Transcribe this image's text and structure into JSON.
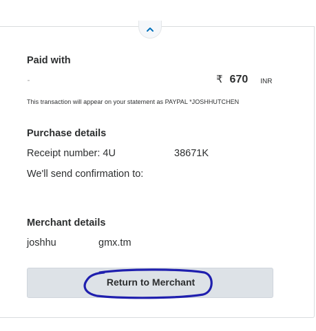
{
  "paid_with": {
    "title": "Paid with",
    "currency_symbol": "₹",
    "amount": "670",
    "currency_code": "INR",
    "statement_note": "This transaction will appear on your statement as PAYPAL *JOSHHUTCHEN"
  },
  "purchase_details": {
    "title": "Purchase details",
    "receipt_label": "Receipt number: 4U",
    "receipt_tail": "38671K",
    "confirmation_text": "We'll send confirmation to:"
  },
  "merchant_details": {
    "title": "Merchant details",
    "email_start": "joshhu",
    "email_end": "gmx.tm"
  },
  "return_button": {
    "label": "Return to Merchant"
  },
  "colors": {
    "button_bg": "#dde2e7",
    "annotation": "#1f1fae",
    "text": "#2c2e2f"
  },
  "icons": {
    "collapse": "chevron-up-icon"
  }
}
